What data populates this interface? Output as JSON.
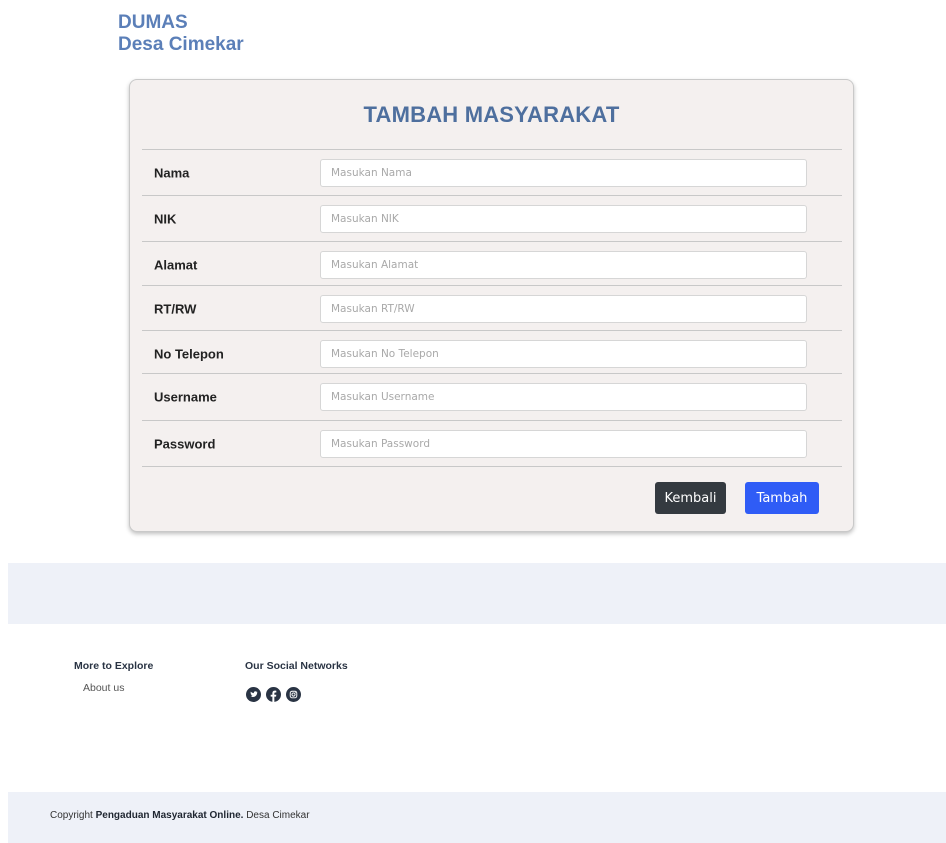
{
  "brand": {
    "line1": "DUMAS",
    "line2": "Desa Cimekar"
  },
  "form": {
    "title": "TAMBAH MASYARAKAT",
    "fields": [
      {
        "label": "Nama",
        "placeholder": "Masukan Nama",
        "value": ""
      },
      {
        "label": "NIK",
        "placeholder": "Masukan NIK",
        "value": ""
      },
      {
        "label": "Alamat",
        "placeholder": "Masukan Alamat",
        "value": ""
      },
      {
        "label": "RT/RW",
        "placeholder": "Masukan RT/RW",
        "value": ""
      },
      {
        "label": "No Telepon",
        "placeholder": "Masukan No Telepon",
        "value": ""
      },
      {
        "label": "Username",
        "placeholder": "Masukan Username",
        "value": ""
      },
      {
        "label": "Password",
        "placeholder": "Masukan Password",
        "value": ""
      }
    ],
    "back_label": "Kembali",
    "submit_label": "Tambah"
  },
  "footer": {
    "explore_heading": "More to Explore",
    "explore_link": "About us",
    "social_heading": "Our Social Networks",
    "social_icons": [
      "twitter-icon",
      "facebook-icon",
      "instagram-icon"
    ],
    "copyright_prefix": "Copyright",
    "copyright_name": "Pengaduan Masyarakat Online.",
    "copyright_suffix": "Desa Cimekar"
  },
  "colors": {
    "brand": "#5b7fb8",
    "card_bg": "#f4f0ef",
    "back_button": "#343a40",
    "submit_button": "#2f5cf6",
    "footer_band": "#eef1f8"
  }
}
